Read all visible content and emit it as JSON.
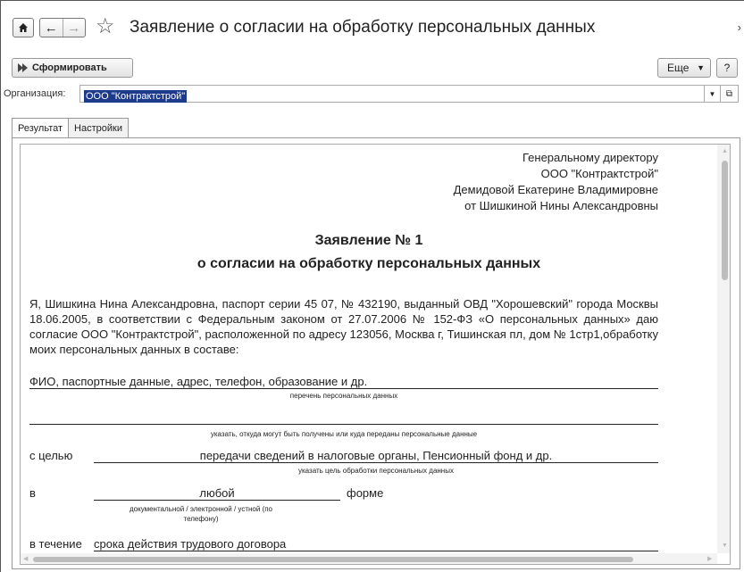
{
  "window": {
    "title": "Заявление о согласии на обработку персональных данных"
  },
  "toolbar": {
    "generate_label": "Сформировать",
    "more_label": "Еще",
    "help_label": "?"
  },
  "organization": {
    "label": "Организация:",
    "value": "ООО \"Контрактстрой\""
  },
  "tabs": [
    {
      "label": "Результат",
      "active": true
    },
    {
      "label": "Настройки",
      "active": false
    }
  ],
  "document": {
    "addressee": [
      "Генеральному директору",
      "ООО \"Контрактстрой\"",
      "Демидовой Екатерине Владимировне",
      "от Шишкиной Нины Александровны"
    ],
    "heading1": "Заявление № 1",
    "heading2": "о согласии на обработку персональных данных",
    "paragraph": "Я, Шишкина Нина Александровна, паспорт серии 45 07, № 432190, выданный ОВД \"Хорошевский\" города Москвы 18.06.2005, в соответствии с Федеральным законом от 27.07.2006 № 152-ФЗ «О персональных данных» даю согласие ООО \"Контрактстрой\", расположенной по адресу 123056, Москва г, Тишинская пл, дом № 1стр1,обработку моих персональных данных в составе:",
    "data_list_value": "ФИО, паспортные данные, адрес, телефон, образование и др.",
    "data_list_caption": "перечень персональных данных",
    "source_caption": "указать, откуда могут быть получены или куда переданы персональные данные",
    "purpose_label": "с целью",
    "purpose_value": "передачи сведений в налоговые органы, Пенсионный фонд и др.",
    "purpose_caption": "указать цель обработки персональных данных",
    "form_label": "в",
    "form_value": "любой",
    "form_suffix": "форме",
    "form_caption": "документальной / электронной / устной (по телефону)",
    "term_label": "в течение",
    "term_value": "срока действия трудового договора"
  },
  "colors": {
    "selection": "#1e3a8a",
    "border": "#999999"
  }
}
